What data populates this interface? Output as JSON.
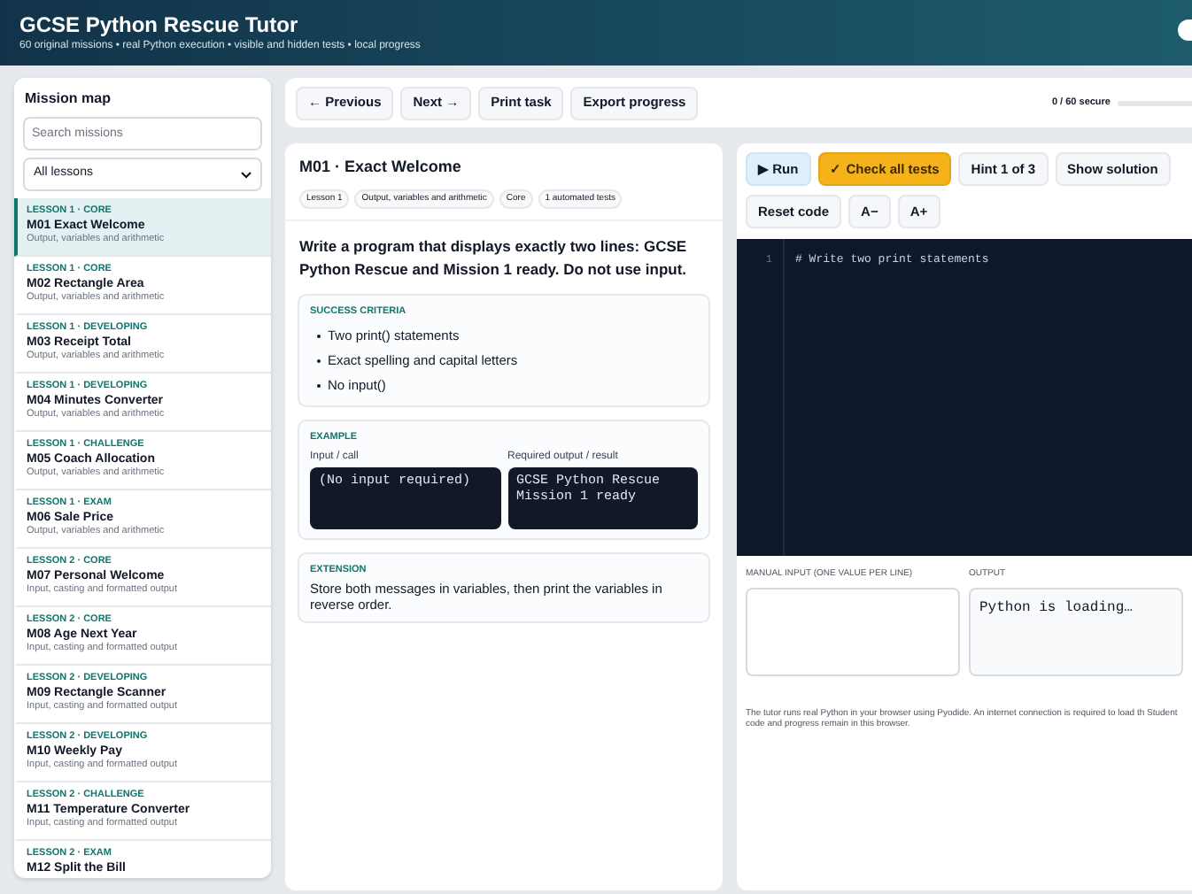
{
  "header": {
    "title": "GCSE Python Rescue Tutor",
    "subtitle": "60 original missions • real Python execution • visible and hidden tests • local progress"
  },
  "sidebar": {
    "title": "Mission map",
    "search": {
      "placeholder": "Search missions"
    },
    "filter": {
      "value": "All lessons"
    },
    "items": [
      {
        "tag": "LESSON 1 · CORE",
        "title": "M01 Exact Welcome",
        "topic": "Output, variables and arithmetic",
        "selected": true
      },
      {
        "tag": "LESSON 1 · CORE",
        "title": "M02 Rectangle Area",
        "topic": "Output, variables and arithmetic",
        "selected": false
      },
      {
        "tag": "LESSON 1 · DEVELOPING",
        "title": "M03 Receipt Total",
        "topic": "Output, variables and arithmetic",
        "selected": false
      },
      {
        "tag": "LESSON 1 · DEVELOPING",
        "title": "M04 Minutes Converter",
        "topic": "Output, variables and arithmetic",
        "selected": false
      },
      {
        "tag": "LESSON 1 · CHALLENGE",
        "title": "M05 Coach Allocation",
        "topic": "Output, variables and arithmetic",
        "selected": false
      },
      {
        "tag": "LESSON 1 · EXAM",
        "title": "M06 Sale Price",
        "topic": "Output, variables and arithmetic",
        "selected": false
      },
      {
        "tag": "LESSON 2 · CORE",
        "title": "M07 Personal Welcome",
        "topic": "Input, casting and formatted output",
        "selected": false
      },
      {
        "tag": "LESSON 2 · CORE",
        "title": "M08 Age Next Year",
        "topic": "Input, casting and formatted output",
        "selected": false
      },
      {
        "tag": "LESSON 2 · DEVELOPING",
        "title": "M09 Rectangle Scanner",
        "topic": "Input, casting and formatted output",
        "selected": false
      },
      {
        "tag": "LESSON 2 · DEVELOPING",
        "title": "M10 Weekly Pay",
        "topic": "Input, casting and formatted output",
        "selected": false
      },
      {
        "tag": "LESSON 2 · CHALLENGE",
        "title": "M11 Temperature Converter",
        "topic": "Input, casting and formatted output",
        "selected": false
      },
      {
        "tag": "LESSON 2 · EXAM",
        "title": "M12 Split the Bill",
        "selected": false
      }
    ]
  },
  "toolbar": {
    "buttons": [
      "← Previous",
      "Next →",
      "Print task",
      "Export progress"
    ],
    "progress": {
      "label": "0 / 60 secure",
      "level": 0
    }
  },
  "task": {
    "title": "M01 · Exact Welcome",
    "tags": [
      "Lesson 1",
      "Output, variables and arithmetic",
      "Core",
      "1 automated tests"
    ],
    "prompt": "Write a program that displays exactly two lines: GCSE Python Rescue and Mission 1 ready. Do not use input.",
    "criteria": {
      "heading": "SUCCESS CRITERIA",
      "items": [
        "Two print() statements",
        "Exact spelling and capital letters",
        "No input()"
      ]
    },
    "example": {
      "heading": "EXAMPLE",
      "input_label": "Input / call",
      "input": "(No input required)",
      "output_label": "Required output / result",
      "output": "GCSE Python Rescue\nMission 1 ready"
    },
    "extension": {
      "heading": "EXTENSION",
      "text": "Store both messages in variables, then print the variables in reverse order."
    }
  },
  "editor": {
    "buttons": [
      {
        "label": "▶ Run",
        "kind": "run"
      },
      {
        "label": "✓ Check all tests",
        "kind": "primary"
      },
      {
        "label": "Hint 1 of 3",
        "kind": "plain"
      },
      {
        "label": "Show solution",
        "kind": "plain"
      },
      {
        "label": "Reset code",
        "kind": "plain"
      },
      {
        "label": "A−",
        "kind": "plain"
      },
      {
        "label": "A+",
        "kind": "plain"
      }
    ],
    "line_numbers": [
      "1"
    ],
    "lines": [
      "# Write two print statements"
    ],
    "input_label": "MANUAL INPUT (ONE VALUE PER LINE)",
    "output_label": "OUTPUT",
    "output": "Python is loading…",
    "note": "The tutor runs real Python in your browser using Pyodide. An internet connection is required to load th Student code and progress remain in this browser."
  }
}
